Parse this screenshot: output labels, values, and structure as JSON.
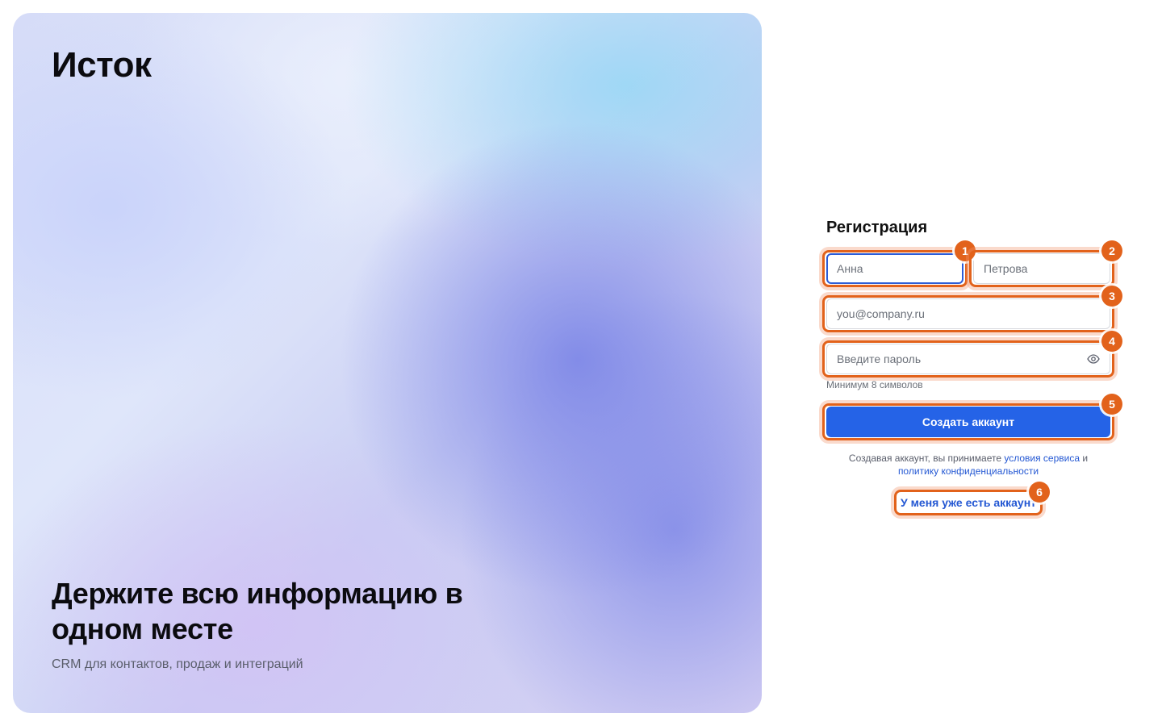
{
  "brand": {
    "name": "Исток"
  },
  "hero": {
    "headline": "Держите всю информацию в одном месте",
    "subtitle": "CRM для контактов, продаж и интеграций"
  },
  "form": {
    "title": "Регистрация",
    "first_name_placeholder": "Анна",
    "last_name_placeholder": "Петрова",
    "email_placeholder": "you@company.ru",
    "password_placeholder": "Введите пароль",
    "password_hint": "Минимум 8 символов",
    "submit_label": "Создать аккаунт",
    "terms_prefix": "Создавая аккаунт, вы принимаете",
    "terms_link": "условия сервиса",
    "terms_and": "и",
    "privacy_link": "политику конфиденциальности",
    "login_link": "У меня уже есть аккаунт"
  },
  "annotations": [
    "1",
    "2",
    "3",
    "4",
    "5",
    "6"
  ],
  "colors": {
    "accent": "#2563e7",
    "link": "#2458d3",
    "annotation": "#e2621b"
  },
  "icons": {
    "password_toggle": "eye-icon"
  }
}
